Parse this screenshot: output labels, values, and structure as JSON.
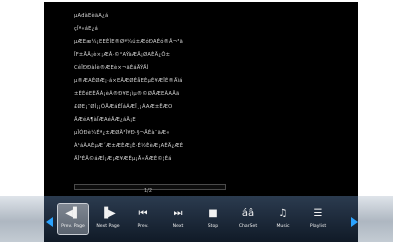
{
  "document": {
    "lines": [
      "µAđàEèäA¿á",
      "çÎª«áE¿á",
      "µÆEæ¼¡EEÈÌE®Øª¼ú±ÆóÐAÉó®Â¬³ä",
      "ÎF±ÅÄ¡è×¡ÆÂ·©°AÝàÆÄ¡ØAÈÄ¿Ô±",
      "CêÏÐÐàÌè®ÆEè×¬äÉáÄÝÄÍ",
      "µ®­ÆAÈ­ØÆ¡·á×EÂÆØÉåEÈµÉ¥Æ­ÎÉ®Äìá",
      "±ÈÉéEÈÄÁ¡èÃ®Ð¥E¡ìµ®­©ØÅÆEÃAÄä",
      "£ØE¡¨ØÌ¡¡ÓÅÆá­ÉÎáÁÆÎ¸¡ÁAÆ±ËÆO",
      "ÄÆéA¶àÏÆAéÂÆ¿áÄ¡E",
      "µÎÓÐè¼Éª¿±ÆØÄ³Î¥Ð·§¬ÄÉà¨äÆ«",
      "À¹áÃAÈµÆ´Æ±ÆÈÆ¡È·É½ÈèÆ¡AÈÄ¿ÆÉ",
      "ÄÎ³ÉÄ©áÆÌ¡Æ¡Æ¥ÆÈµ¡Å«ÄÆÉ©¦Èá"
    ]
  },
  "progress": {
    "label": "1/2",
    "fraction": 0.0
  },
  "toolbar": {
    "accent_color": "#2aa3ff",
    "buttons": [
      {
        "label": "Prev. Page",
        "icon": "prev-page-icon",
        "glyph": "◀▌"
      },
      {
        "label": "Next Page",
        "icon": "next-page-icon",
        "glyph": "▐▶"
      },
      {
        "label": "Prev.",
        "icon": "prev-icon",
        "glyph": "⏮"
      },
      {
        "label": "Next",
        "icon": "next-icon",
        "glyph": "⏭"
      },
      {
        "label": "Stop",
        "icon": "stop-icon",
        "glyph": "■"
      },
      {
        "label": "CharSet",
        "icon": "charset-icon",
        "glyph": "áâ"
      },
      {
        "label": "Music",
        "icon": "music-icon",
        "glyph": "♫"
      },
      {
        "label": "Playlist",
        "icon": "playlist-icon",
        "glyph": "☰"
      }
    ]
  }
}
